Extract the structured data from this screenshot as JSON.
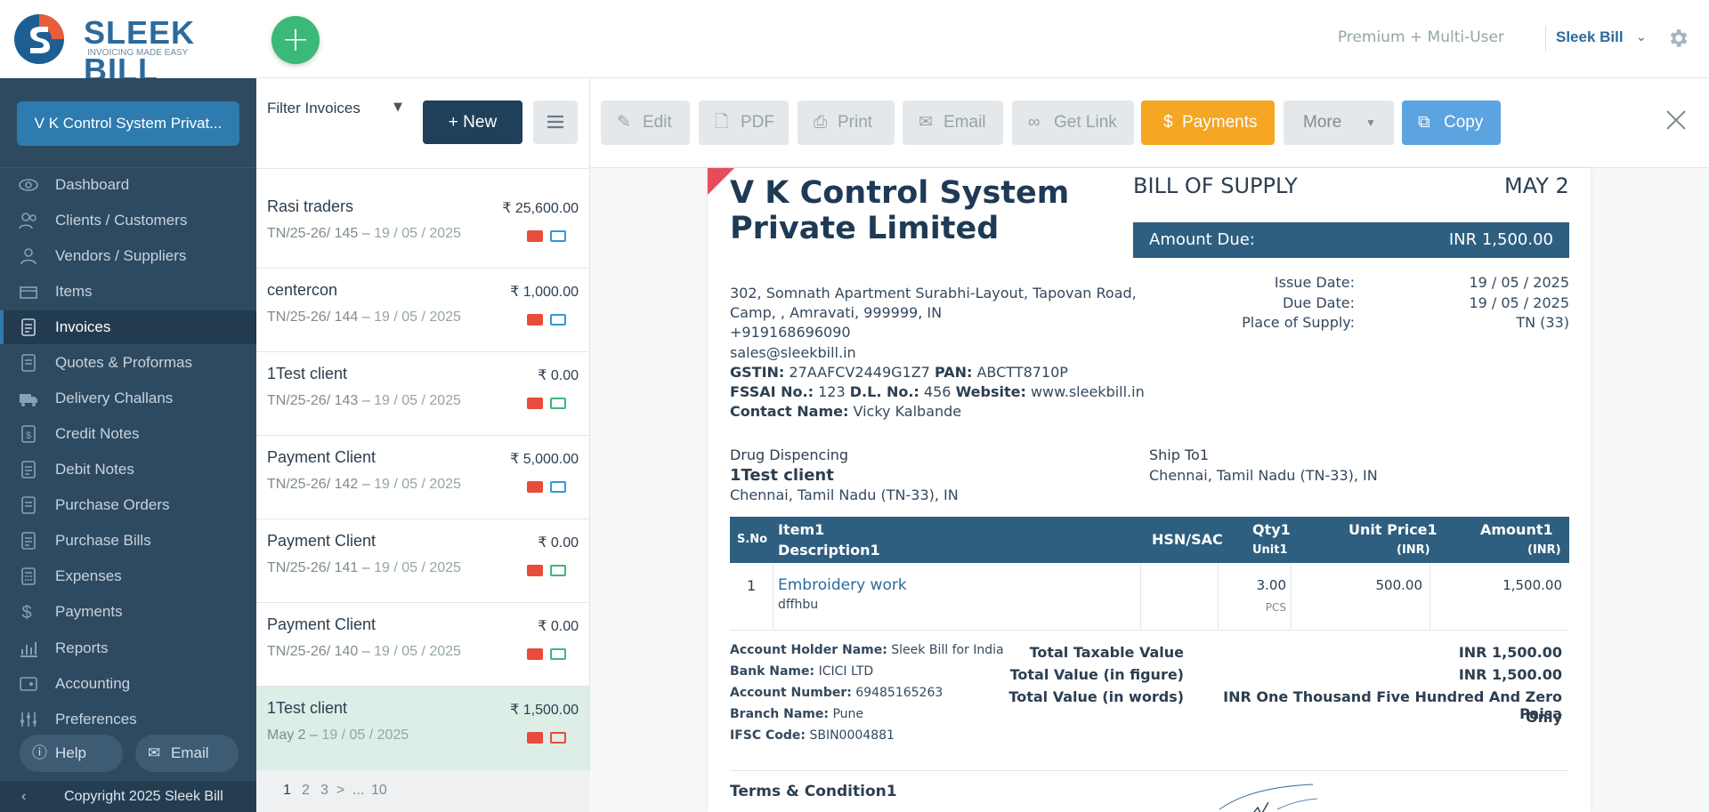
{
  "header": {
    "logo_text": "SLEEK BILL",
    "logo_tagline": "INVOICING MADE EASY",
    "plan": "Premium + Multi-User",
    "user": "Sleek Bill"
  },
  "sidebar": {
    "company": "V K Control System Privat...",
    "items": [
      {
        "label": "Dashboard",
        "icon": "eye-icon"
      },
      {
        "label": "Clients / Customers",
        "icon": "users-icon"
      },
      {
        "label": "Vendors / Suppliers",
        "icon": "users-icon"
      },
      {
        "label": "Items",
        "icon": "box-icon"
      },
      {
        "label": "Invoices",
        "icon": "document-icon"
      },
      {
        "label": "Quotes & Proformas",
        "icon": "document-icon"
      },
      {
        "label": "Delivery Challans",
        "icon": "truck-icon"
      },
      {
        "label": "Credit Notes",
        "icon": "dollar-doc-icon"
      },
      {
        "label": "Debit Notes",
        "icon": "document-icon"
      },
      {
        "label": "Purchase Orders",
        "icon": "document-icon"
      },
      {
        "label": "Purchase Bills",
        "icon": "document-icon"
      },
      {
        "label": "Expenses",
        "icon": "calculator-icon"
      },
      {
        "label": "Payments",
        "icon": "dollar-icon"
      },
      {
        "label": "Reports",
        "icon": "bar-chart-icon"
      },
      {
        "label": "Accounting",
        "icon": "ledger-icon"
      },
      {
        "label": "Preferences",
        "icon": "sliders-icon"
      }
    ],
    "help": "Help",
    "email": "Email",
    "copyright": "Copyright 2025 Sleek Bill"
  },
  "list": {
    "filter": "Filter Invoices",
    "new_label": "New",
    "invoices": [
      {
        "client": "Rasi traders",
        "amount": "₹ 25,600.00",
        "number": "TN/25-26/ 145",
        "date": "19 / 05 / 2025",
        "status": "blue"
      },
      {
        "client": "centercon",
        "amount": "₹ 1,000.00",
        "number": "TN/25-26/ 144",
        "date": "19 / 05 / 2025",
        "status": "blue"
      },
      {
        "client": "1Test client",
        "amount": "₹ 0.00",
        "number": "TN/25-26/ 143",
        "date": "19 / 05 / 2025",
        "status": "green"
      },
      {
        "client": "Payment Client",
        "amount": "₹ 5,000.00",
        "number": "TN/25-26/ 142",
        "date": "19 / 05 / 2025",
        "status": "blue"
      },
      {
        "client": "Payment Client",
        "amount": "₹ 0.00",
        "number": "TN/25-26/ 141",
        "date": "19 / 05 / 2025",
        "status": "green"
      },
      {
        "client": "Payment Client",
        "amount": "₹ 0.00",
        "number": "TN/25-26/ 140",
        "date": "19 / 05 / 2025",
        "status": "green"
      },
      {
        "client": "1Test client",
        "amount": "₹ 1,500.00",
        "number": "May 2",
        "date": "19 / 05 / 2025",
        "status": "red"
      }
    ],
    "pager": {
      "p1": "1",
      "p2": "2",
      "p3": "3",
      "next": ">",
      "ellipsis": "...",
      "last": "10"
    }
  },
  "toolbar": {
    "edit": "Edit",
    "pdf": "PDF",
    "print": "Print",
    "email": "Email",
    "get_link": "Get Link",
    "payments": "Payments",
    "more": "More",
    "copy": "Copy"
  },
  "invoice": {
    "business_name": "V K Control System Private Limited",
    "doc_type": "BILL OF SUPPLY",
    "doc_number": "MAY 2",
    "amount_due_label": "Amount Due:",
    "amount_due": "INR 1,500.00",
    "address_line1": "302, Somnath Apartment Surabhi-Layout, Tapovan Road,",
    "address_line2": "Camp, , Amravati, 999999, IN",
    "phone": "+919168696090",
    "email": "sales@sleekbill.in",
    "gstin_label": "GSTIN:",
    "gstin": "27AAFCV2449G1Z7",
    "pan_label": "PAN:",
    "pan": "ABCTT8710P",
    "fssai_label": "FSSAI No.:",
    "fssai": "123",
    "dl_label": "D.L. No.:",
    "dl": "456",
    "website_label": "Website:",
    "website": "www.sleekbill.in",
    "contact_label": "Contact Name:",
    "contact": "Vicky Kalbande",
    "issue_date_label": "Issue Date:",
    "issue_date": "19 / 05 / 2025",
    "due_date_label": "Due Date:",
    "due_date": "19 / 05 / 2025",
    "place_label": "Place of Supply:",
    "place": "TN (33)",
    "bill_to_title": "Drug Dispencing",
    "bill_to_name": "1Test client",
    "bill_to_addr": "Chennai, Tamil Nadu (TN-33), IN",
    "ship_to_title": "Ship To1",
    "ship_to_addr": "Chennai, Tamil Nadu (TN-33), IN",
    "table": {
      "h_sno": "S.No",
      "h_item": "Item1",
      "h_desc": "Description1",
      "h_hsn": "HSN/SAC",
      "h_qty": "Qty1",
      "h_unit": "Unit1",
      "h_price": "Unit Price1",
      "h_price_cur": "(INR)",
      "h_amount": "Amount1",
      "h_amount_cur": "(INR)",
      "rows": [
        {
          "sno": "1",
          "item": "Embroidery work",
          "desc": "dffhbu",
          "qty": "3.00",
          "unit": "PCS",
          "price": "500.00",
          "amount": "1,500.00"
        }
      ]
    },
    "bank": {
      "holder_label": "Account Holder Name:",
      "holder": "Sleek Bill for India",
      "bank_label": "Bank Name:",
      "bank": "ICICI LTD",
      "acct_label": "Account Number:",
      "acct": "69485165263",
      "branch_label": "Branch Name:",
      "branch": "Pune",
      "ifsc_label": "IFSC Code:",
      "ifsc": "SBIN0004881"
    },
    "totals": {
      "taxable_label": "Total Taxable Value",
      "taxable": "INR 1,500.00",
      "figure_label": "Total Value (in figure)",
      "figure": "INR 1,500.00",
      "words_label": "Total Value (in words)",
      "words_line1": "INR One Thousand Five Hundred And Zero Paisa",
      "words_line2": "Only"
    },
    "terms_title": "Terms & Condition1"
  },
  "colors": {
    "sidebar": "#2e4a60",
    "accent": "#2e7bb0",
    "payments": "#f5a623",
    "copy": "#5ba4e0",
    "add": "#3cb878"
  }
}
